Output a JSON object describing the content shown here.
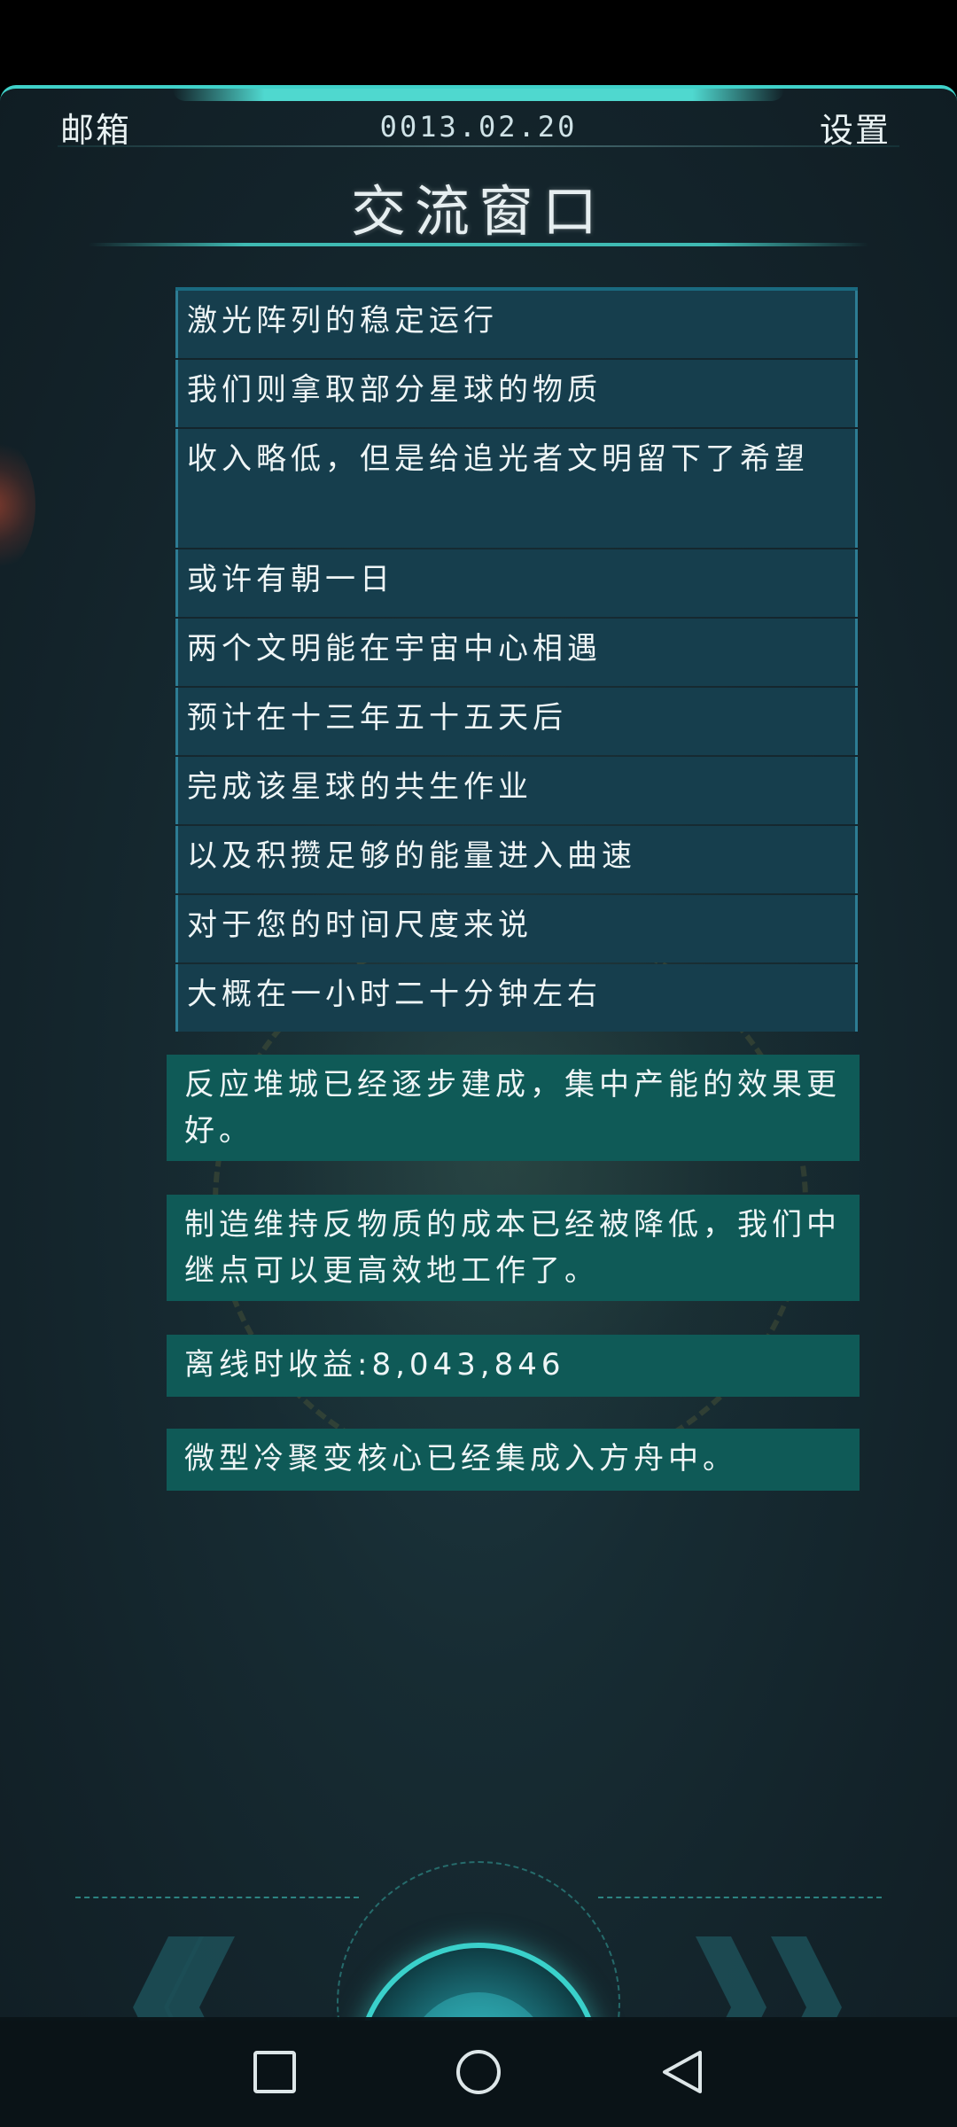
{
  "header": {
    "mailbox_label": "邮箱",
    "date": "0013.02.20",
    "settings_label": "设置",
    "title": "交流窗口"
  },
  "messages": [
    {
      "text": "激光阵列的稳定运行"
    },
    {
      "text": "我们则拿取部分星球的物质"
    },
    {
      "text": "收入略低，但是给追光者文明留下了希望"
    },
    {
      "text": "或许有朝一日"
    },
    {
      "text": "两个文明能在宇宙中心相遇"
    },
    {
      "text": "预计在十三年五十五天后"
    },
    {
      "text": "完成该星球的共生作业"
    },
    {
      "text": "以及积攒足够的能量进入曲速"
    },
    {
      "text": "对于您的时间尺度来说"
    },
    {
      "text": "大概在一小时二十分钟左右"
    }
  ],
  "events": [
    {
      "text": "反应堆城已经逐步建成，集中产能的效果更好。"
    },
    {
      "text": "制造维持反物质的成本已经被降低，我们中继点可以更高效地工作了。"
    },
    {
      "text": "离线时收益:8,043,846"
    },
    {
      "text": "微型冷聚变核心已经集成入方舟中。"
    }
  ],
  "controls": {
    "prev_icon": "double-chevron-left-icon",
    "center_icon": "stop-icon",
    "next_icon": "double-chevron-right-icon"
  },
  "navigation": {
    "recents_icon": "square-icon",
    "home_icon": "circle-icon",
    "back_icon": "triangle-back-icon"
  },
  "colors": {
    "accent": "#3fd1c9",
    "dialog_bg": "#163e4d",
    "event_bg": "#0f5a57"
  }
}
